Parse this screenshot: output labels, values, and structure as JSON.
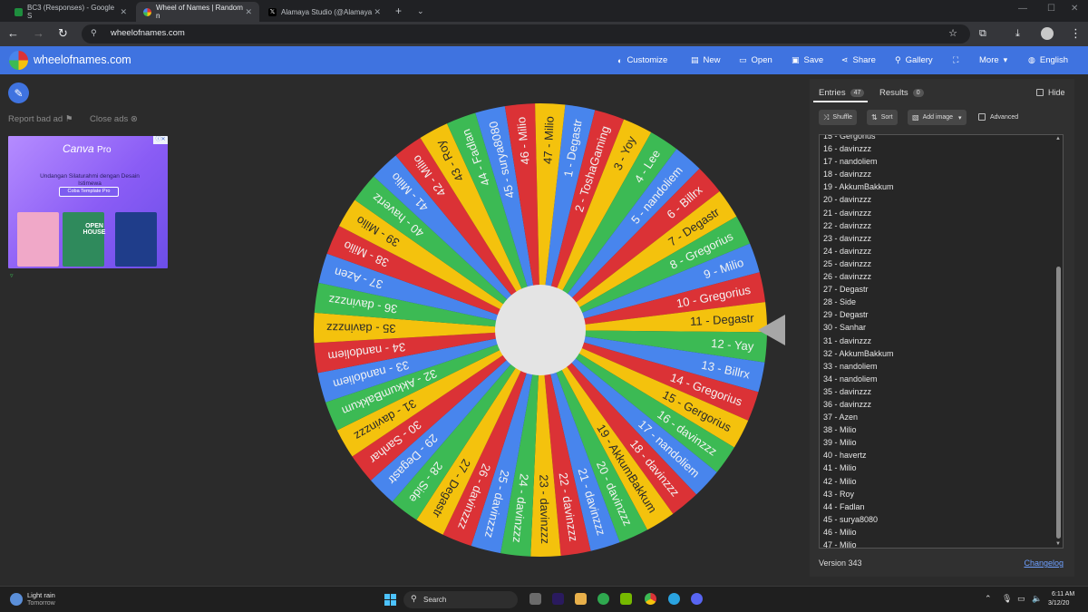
{
  "browser": {
    "tabs": [
      {
        "title": "BC3 (Responses) - Google S",
        "icon": "sheets-icon",
        "color": "#1e8e3e"
      },
      {
        "title": "Wheel of Names | Random n",
        "icon": "wheel-icon",
        "color": "#4285f4"
      },
      {
        "title": "Alamaya Studio (@Alamaya",
        "icon": "x-icon",
        "color": "#000000"
      }
    ],
    "url": "wheelofnames.com"
  },
  "site": {
    "title": "wheelofnames.com",
    "menu": [
      {
        "label": "Customize",
        "icon": "palette-icon"
      },
      {
        "label": "New",
        "icon": "file-icon"
      },
      {
        "label": "Open",
        "icon": "folder-icon"
      },
      {
        "label": "Save",
        "icon": "save-icon"
      },
      {
        "label": "Share",
        "icon": "share-icon"
      },
      {
        "label": "Gallery",
        "icon": "search-icon"
      },
      {
        "label": "",
        "icon": "fullscreen-icon"
      },
      {
        "label": "More",
        "icon": "chevron-down-icon"
      },
      {
        "label": "English",
        "icon": "globe-icon"
      }
    ]
  },
  "ads": {
    "report": "Report bad ad",
    "close": "Close ads",
    "brand": "Canva",
    "brand_suffix": "Pro",
    "headline": "Undangan Silaturahmi dengan Desain Istimewa",
    "cta": "Coba Template Pro",
    "card_label": "OPEN HOUSE"
  },
  "wheel": {
    "segments": [
      "1 - Degastr",
      "2 - ToshaGaming",
      "3 - Yoy",
      "4 - Lee",
      "5 - nandoliem",
      "6 - Billrx",
      "7 - Degastr",
      "8 - Gregorius",
      "9 - Milio",
      "10 - Gregorius",
      "11 - Degastr",
      "12 - Yay",
      "13 - Billrx",
      "14 - Gregorius",
      "15 - Gergorius",
      "16 - davinzzz",
      "17 - nandoliem",
      "18 - davinzzz",
      "19 - AkkumBakkum",
      "20 - davinzzz",
      "21 - davinzzz",
      "22 - davinzzz",
      "23 - davinzzz",
      "24 - davinzzz",
      "25 - davinzzz",
      "26 - davinzzz",
      "27 - Degastr",
      "28 - Side",
      "29 - Degastr",
      "30 - Sanhar",
      "31 - davinzzz",
      "32 - AkkumBakkum",
      "33 - nandoliem",
      "34 - nandoliem",
      "35 - davinzzz",
      "36 - davinzzz",
      "37 - Azen",
      "38 - Milio",
      "39 - Milio",
      "40 - havertz",
      "41 - Milio",
      "42 - Milio",
      "43 - Roy",
      "44 - Fadlan",
      "45 - surya8080",
      "46 - Milio",
      "47 - Milio"
    ],
    "colors": [
      "#4885ed",
      "#db3236",
      "#f4c20d",
      "#3cba54"
    ],
    "center_color": "#e4e4e4",
    "pointer_color": "#a7a7a7"
  },
  "panel": {
    "tab_entries": "Entries",
    "entries_count": "47",
    "tab_results": "Results",
    "results_count": "0",
    "hide": "Hide",
    "shuffle": "Shuffle",
    "sort": "Sort",
    "add_image": "Add image",
    "advanced": "Advanced",
    "entries": [
      "15 - Gergorius",
      "16 - davinzzz",
      "17 - nandoliem",
      "18 - davinzzz",
      "19 - AkkumBakkum",
      "20 - davinzzz",
      "21 - davinzzz",
      "22 - davinzzz",
      "23 - davinzzz",
      "24 - davinzzz",
      "25 - davinzzz",
      "26 - davinzzz",
      "27 - Degastr",
      "28 - Side",
      "29 - Degastr",
      "30 - Sanhar",
      "31 - davinzzz",
      "32 - AkkumBakkum",
      "33 - nandoliem",
      "34 - nandoliem",
      "35 - davinzzz",
      "36 - davinzzz",
      "37 - Azen",
      "38 - Milio",
      "39 - Milio",
      "40 - havertz",
      "41 - Milio",
      "42 - Milio",
      "43 - Roy",
      "44 - Fadlan",
      "45 - surya8080",
      "46 - Milio",
      "47 - Milio"
    ],
    "version": "Version 343",
    "changelog": "Changelog"
  },
  "taskbar": {
    "weather": "Light rain",
    "weather_sub": "Tomorrow",
    "search": "Search",
    "time": "6:11 AM",
    "date": "3/12/20"
  }
}
